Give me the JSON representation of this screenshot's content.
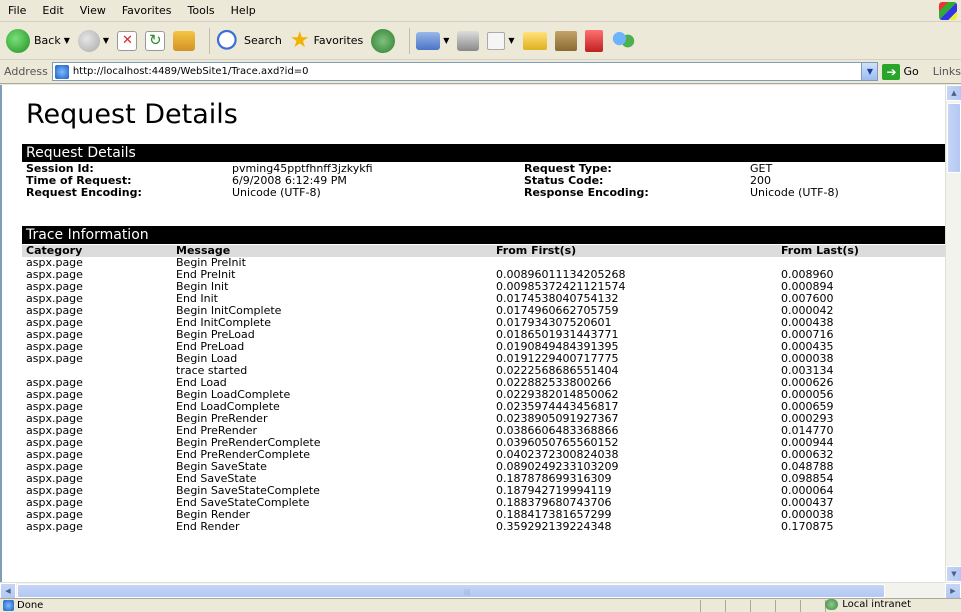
{
  "menu": [
    "File",
    "Edit",
    "View",
    "Favorites",
    "Tools",
    "Help"
  ],
  "toolbar": {
    "back": "Back",
    "search": "Search",
    "favorites": "Favorites"
  },
  "address": {
    "label": "Address",
    "url": "http://localhost:4489/WebSite1/Trace.axd?id=0",
    "go": "Go",
    "links": "Links"
  },
  "page": {
    "title": "Request Details",
    "request_section": "Request Details",
    "trace_section": "Trace Information"
  },
  "request_details": {
    "session_id_label": "Session Id:",
    "session_id": "pvming45pptfhnff3jzkykfi",
    "time_label": "Time of Request:",
    "time": "6/9/2008 6:12:49 PM",
    "req_enc_label": "Request Encoding:",
    "req_enc": "Unicode (UTF-8)",
    "req_type_label": "Request Type:",
    "req_type": "GET",
    "status_label": "Status Code:",
    "status": "200",
    "resp_enc_label": "Response Encoding:",
    "resp_enc": "Unicode (UTF-8)"
  },
  "trace": {
    "headers": [
      "Category",
      "Message",
      "From First(s)",
      "From Last(s)"
    ],
    "rows": [
      [
        "aspx.page",
        "Begin PreInit",
        "",
        ""
      ],
      [
        "aspx.page",
        "End PreInit",
        "0.00896011134205268",
        "0.008960"
      ],
      [
        "aspx.page",
        "Begin Init",
        "0.00985372421121574",
        "0.000894"
      ],
      [
        "aspx.page",
        "End Init",
        "0.0174538040754132",
        "0.007600"
      ],
      [
        "aspx.page",
        "Begin InitComplete",
        "0.0174960662705759",
        "0.000042"
      ],
      [
        "aspx.page",
        "End InitComplete",
        "0.017934307520601",
        "0.000438"
      ],
      [
        "aspx.page",
        "Begin PreLoad",
        "0.0186501931443771",
        "0.000716"
      ],
      [
        "aspx.page",
        "End PreLoad",
        "0.0190849484391395",
        "0.000435"
      ],
      [
        "aspx.page",
        "Begin Load",
        "0.0191229400717775",
        "0.000038"
      ],
      [
        "",
        "trace started",
        "0.0222568686551404",
        "0.003134"
      ],
      [
        "aspx.page",
        "End Load",
        "0.022882533800266",
        "0.000626"
      ],
      [
        "aspx.page",
        "Begin LoadComplete",
        "0.0229382014850062",
        "0.000056"
      ],
      [
        "aspx.page",
        "End LoadComplete",
        "0.0235974443456817",
        "0.000659"
      ],
      [
        "aspx.page",
        "Begin PreRender",
        "0.0238905091927367",
        "0.000293"
      ],
      [
        "aspx.page",
        "End PreRender",
        "0.0386606483368866",
        "0.014770"
      ],
      [
        "aspx.page",
        "Begin PreRenderComplete",
        "0.0396050765560152",
        "0.000944"
      ],
      [
        "aspx.page",
        "End PreRenderComplete",
        "0.0402372300824038",
        "0.000632"
      ],
      [
        "aspx.page",
        "Begin SaveState",
        "0.0890249233103209",
        "0.048788"
      ],
      [
        "aspx.page",
        "End SaveState",
        "0.187878699316309",
        "0.098854"
      ],
      [
        "aspx.page",
        "Begin SaveStateComplete",
        "0.187942719994119",
        "0.000064"
      ],
      [
        "aspx.page",
        "End SaveStateComplete",
        "0.188379680743706",
        "0.000437"
      ],
      [
        "aspx.page",
        "Begin Render",
        "0.188417381657299",
        "0.000038"
      ],
      [
        "aspx.page",
        "End Render",
        "0.359292139224348",
        "0.170875"
      ]
    ]
  },
  "status": {
    "left": "Done",
    "zone": "Local intranet"
  }
}
